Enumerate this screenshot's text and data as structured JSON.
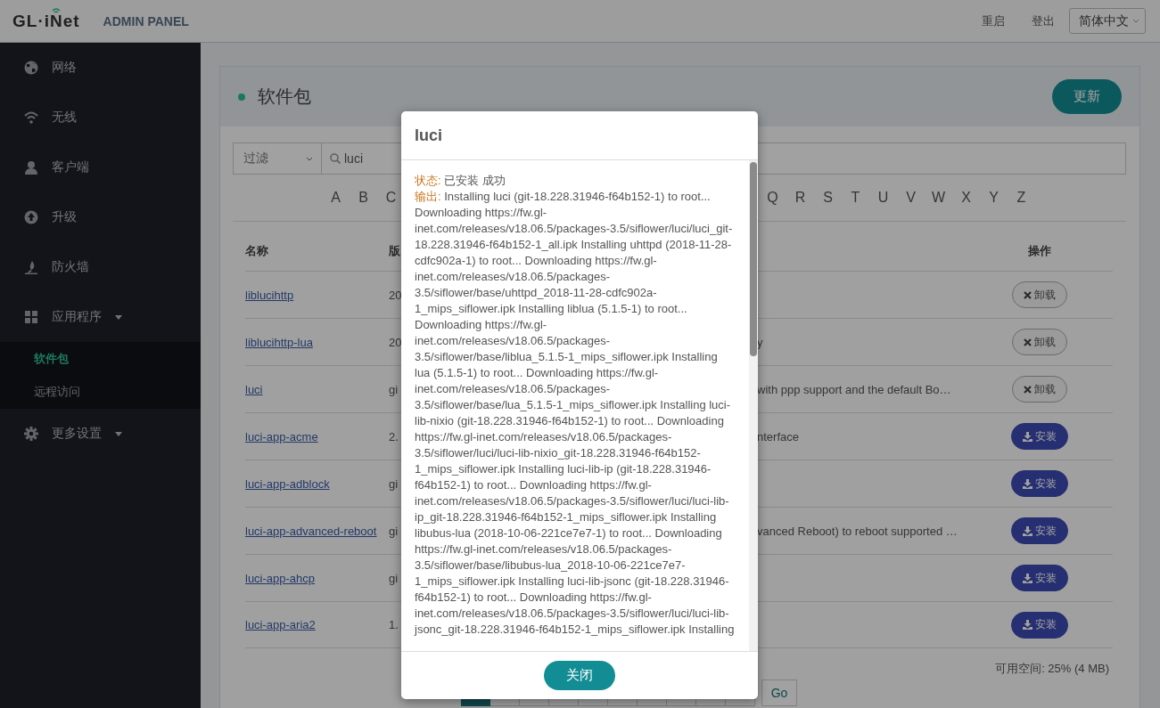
{
  "header": {
    "logo": "GL·iNet",
    "subtitle": "ADMIN PANEL",
    "links": [
      "重启",
      "登出"
    ],
    "language": "简体中文"
  },
  "sidebar": {
    "items": [
      {
        "label": "网络"
      },
      {
        "label": "无线"
      },
      {
        "label": "客户端"
      },
      {
        "label": "升级"
      },
      {
        "label": "防火墙"
      },
      {
        "label": "应用程序",
        "expanded": true,
        "children": [
          {
            "label": "软件包",
            "selected": true
          },
          {
            "label": "远程访问",
            "selected": false
          }
        ]
      },
      {
        "label": "更多设置",
        "expanded": false
      }
    ]
  },
  "panel": {
    "title": "软件包",
    "update_button": "更新",
    "filter": {
      "value": "过滤"
    },
    "search": {
      "value": "luci"
    },
    "letters_left": [
      "A",
      "B",
      "C"
    ],
    "letters_right": [
      "Q",
      "R",
      "S",
      "T",
      "U",
      "V",
      "W",
      "X",
      "Y",
      "Z"
    ],
    "table": {
      "columns": [
        {
          "label": "名称"
        },
        {
          "label": "版"
        },
        {
          "label": "操作"
        }
      ],
      "rows": [
        {
          "name": "liblucihttp",
          "version": "20",
          "kind": "installed",
          "action": "卸载"
        },
        {
          "name": "liblucihttp-lua",
          "version": "20",
          "description": "y",
          "kind": "installed",
          "action": "卸载"
        },
        {
          "name": "luci",
          "version": "gi",
          "description": "with ppp support and the default Bo…",
          "kind": "installed",
          "action": "卸载"
        },
        {
          "name": "luci-app-acme",
          "version": "2.",
          "description": "nterface",
          "kind": "available",
          "action": "安装"
        },
        {
          "name": "luci-app-adblock",
          "version": "gi",
          "kind": "available",
          "action": "安装"
        },
        {
          "name": "luci-app-advanced-reboot",
          "version": "gi",
          "description": "vanced Reboot) to reboot supported …",
          "kind": "available",
          "action": "安装"
        },
        {
          "name": "luci-app-ahcp",
          "version": "gi",
          "kind": "available",
          "action": "安装"
        },
        {
          "name": "luci-app-aria2",
          "version": "1.",
          "kind": "available",
          "action": "安装"
        }
      ]
    },
    "free_space": "可用空间: 25% (4 MB)",
    "pages": [
      {
        "selected": true
      },
      {
        "selected": false
      },
      {
        "selected": false
      },
      {
        "selected": false
      },
      {
        "selected": false
      },
      {
        "selected": false
      },
      {
        "selected": false
      },
      {
        "selected": false
      },
      {
        "selected": false
      },
      {
        "selected": false
      }
    ],
    "go_button": "Go"
  },
  "dialog": {
    "title": "luci",
    "status_label": "状态:",
    "status": "已安装 成功",
    "output_label": "输出:",
    "output": "Installing luci (git-18.228.31946-f64b152-1) to root... Downloading https://fw.gl-inet.com/releases/v18.06.5/packages-3.5/siflower/luci/luci_git-18.228.31946-f64b152-1_all.ipk Installing uhttpd (2018-11-28-cdfc902a-1) to root... Downloading https://fw.gl-inet.com/releases/v18.06.5/packages-3.5/siflower/base/uhttpd_2018-11-28-cdfc902a-1_mips_siflower.ipk Installing liblua (5.1.5-1) to root... Downloading https://fw.gl-inet.com/releases/v18.06.5/packages-3.5/siflower/base/liblua_5.1.5-1_mips_siflower.ipk Installing lua (5.1.5-1) to root... Downloading https://fw.gl-inet.com/releases/v18.06.5/packages-3.5/siflower/base/lua_5.1.5-1_mips_siflower.ipk Installing luci-lib-nixio (git-18.228.31946-f64b152-1) to root... Downloading https://fw.gl-inet.com/releases/v18.06.5/packages-3.5/siflower/luci/luci-lib-nixio_git-18.228.31946-f64b152-1_mips_siflower.ipk Installing luci-lib-ip (git-18.228.31946-f64b152-1) to root... Downloading https://fw.gl-inet.com/releases/v18.06.5/packages-3.5/siflower/luci/luci-lib-ip_git-18.228.31946-f64b152-1_mips_siflower.ipk Installing libubus-lua (2018-10-06-221ce7e7-1) to root... Downloading https://fw.gl-inet.com/releases/v18.06.5/packages-3.5/siflower/base/libubus-lua_2018-10-06-221ce7e7-1_mips_siflower.ipk Installing luci-lib-jsonc (git-18.228.31946-f64b152-1) to root... Downloading https://fw.gl-inet.com/releases/v18.06.5/packages-3.5/siflower/luci/luci-lib-jsonc_git-18.228.31946-f64b152-1_mips_siflower.ipk Installing",
    "close_button": "关闭"
  }
}
